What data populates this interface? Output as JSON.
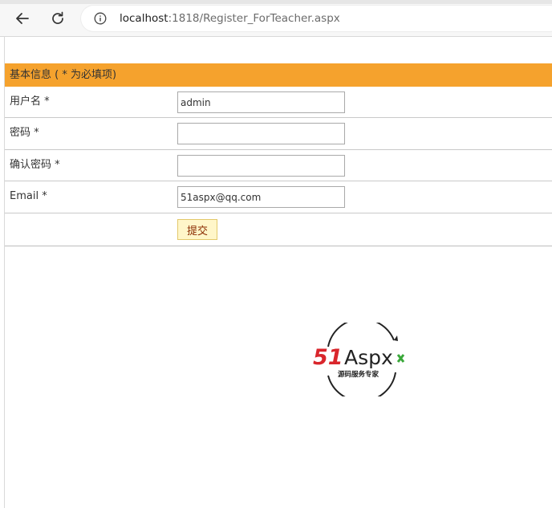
{
  "browser": {
    "url_host": "localhost",
    "url_rest": ":1818/Register_ForTeacher.aspx"
  },
  "form": {
    "header": "基本信息 ( * 为必填项)",
    "fields": [
      {
        "label": "用户名 *",
        "value": "admin",
        "placeholder": ""
      },
      {
        "label": "密码 *",
        "value": "",
        "placeholder": ""
      },
      {
        "label": "确认密码 *",
        "value": "",
        "placeholder": ""
      },
      {
        "label": "Email *",
        "value": "51aspx@qq.com",
        "placeholder": ""
      }
    ],
    "submit_label": "提交"
  },
  "logo": {
    "brand_number": "51",
    "brand_text": "Aspx",
    "tagline": "源码服务专家",
    "colors": {
      "red": "#d9262c",
      "green": "#3aa83a",
      "dark": "#222222"
    }
  },
  "colors": {
    "header_bg": "#f5a22d",
    "button_bg": "#fff6c9"
  }
}
